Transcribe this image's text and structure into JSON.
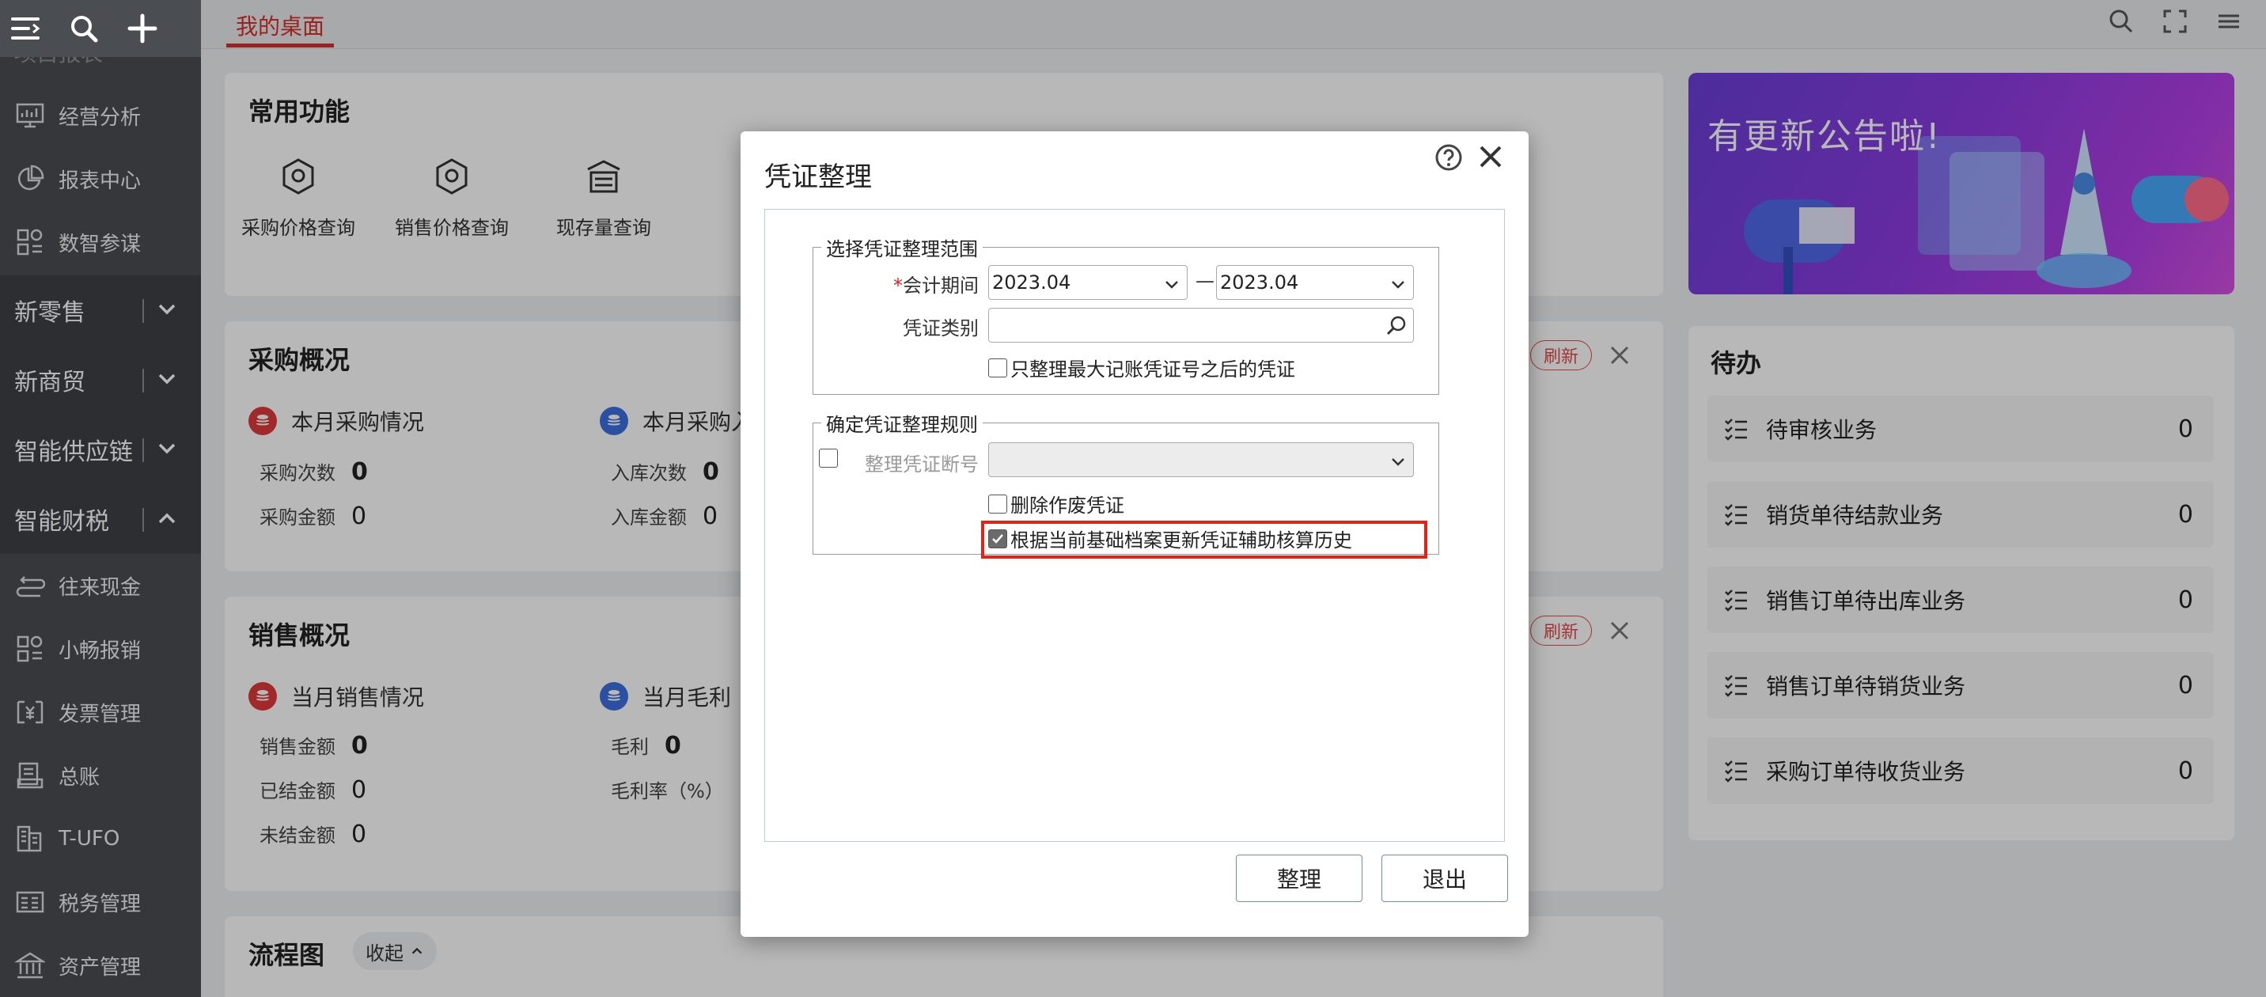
{
  "sidebar": {
    "cut_item": "项目报表",
    "items_top": [
      {
        "label": "经营分析",
        "icon": "chart-board-icon"
      },
      {
        "label": "报表中心",
        "icon": "pie-chart-icon"
      },
      {
        "label": "数智参谋",
        "icon": "grid-apps-icon"
      }
    ],
    "groups": [
      {
        "label": "新零售"
      },
      {
        "label": "新商贸"
      },
      {
        "label": "智能供应链"
      },
      {
        "label": "智能财税"
      }
    ],
    "items_bottom": [
      {
        "label": "往来现金",
        "icon": "exchange-icon"
      },
      {
        "label": "小畅报销",
        "icon": "grid-apps-icon"
      },
      {
        "label": "发票管理",
        "icon": "invoice-icon"
      },
      {
        "label": "总账",
        "icon": "ledger-icon"
      },
      {
        "label": "T-UFO",
        "icon": "building-icon"
      },
      {
        "label": "税务管理",
        "icon": "tax-icon"
      },
      {
        "label": "资产管理",
        "icon": "bank-icon"
      }
    ]
  },
  "topbar": {
    "tab_home": "我的桌面"
  },
  "common": {
    "title": "常用功能",
    "tools": [
      "采购价格查询",
      "销售价格查询",
      "现存量查询"
    ]
  },
  "purchase": {
    "title": "采购概况",
    "left_head": "本月采购情况",
    "right_head": "本月采购入",
    "rows": [
      {
        "label": "采购次数",
        "value": "0"
      },
      {
        "label": "采购金额",
        "value": "0"
      }
    ],
    "right_rows": [
      {
        "label": "入库次数",
        "value": "0"
      },
      {
        "label": "入库金额",
        "value": "0"
      }
    ],
    "refresh": "刷新"
  },
  "sales": {
    "title": "销售概况",
    "left_head": "当月销售情况",
    "right_head": "当月毛利",
    "rows": [
      {
        "label": "销售金额",
        "value": "0"
      },
      {
        "label": "已结金额",
        "value": "0"
      },
      {
        "label": "未结金额",
        "value": "0"
      }
    ],
    "right_rows": [
      {
        "label": "毛利",
        "value": "0"
      },
      {
        "label": "毛利率（%）",
        "value": ""
      }
    ],
    "refresh": "刷新"
  },
  "flow": {
    "title": "流程图",
    "collapse": "收起"
  },
  "banner": {
    "text": "有更新公告啦!"
  },
  "todo": {
    "title": "待办",
    "items": [
      {
        "label": "待审核业务",
        "count": "0"
      },
      {
        "label": "销货单待结款业务",
        "count": "0"
      },
      {
        "label": "销售订单待出库业务",
        "count": "0"
      },
      {
        "label": "销售订单待销货业务",
        "count": "0"
      },
      {
        "label": "采购订单待收货业务",
        "count": "0"
      }
    ]
  },
  "dialog": {
    "title": "凭证整理",
    "range_legend": "选择凭证整理范围",
    "period_label": "会计期间",
    "period_required_mark": "*",
    "period_from": "2023.04",
    "period_dash": "—",
    "period_to": "2023.04",
    "type_label": "凭证类别",
    "type_value": "",
    "only_after_label": "只整理最大记账凭证号之后的凭证",
    "only_after_checked": false,
    "rule_legend": "确定凭证整理规则",
    "break_label": "整理凭证断号",
    "break_checked": false,
    "delete_label": "删除作废凭证",
    "delete_checked": false,
    "update_label": "根据当前基础档案更新凭证辅助核算历史",
    "update_checked": true,
    "ok_button": "整理",
    "exit_button": "退出"
  }
}
